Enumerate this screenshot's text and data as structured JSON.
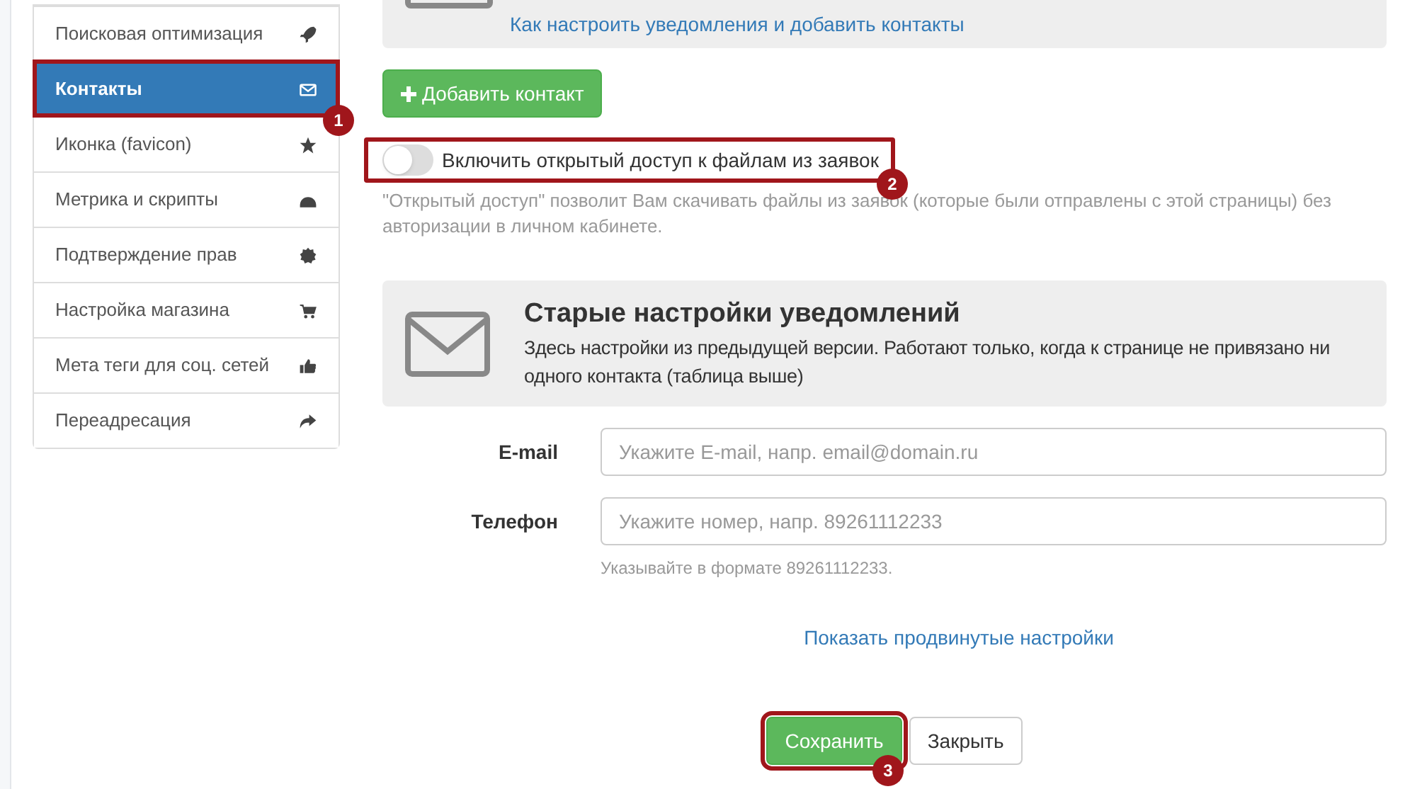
{
  "sidebar": {
    "items": [
      {
        "label": "Поисковая оптимизация",
        "selected": false
      },
      {
        "label": "Контакты",
        "selected": true
      },
      {
        "label": "Иконка (favicon)",
        "selected": false
      },
      {
        "label": "Метрика и скрипты",
        "selected": false
      },
      {
        "label": "Подтверждение прав",
        "selected": false
      },
      {
        "label": "Настройка магазина",
        "selected": false
      },
      {
        "label": "Мета теги для соц. сетей",
        "selected": false
      },
      {
        "label": "Переадресация",
        "selected": false
      }
    ]
  },
  "info_box": {
    "link": "Как настроить уведомления и добавить контакты"
  },
  "add_contact_button": "Добавить контакт",
  "open_access": {
    "label": "Включить открытый доступ к файлам из заявок",
    "on": false,
    "hint": "\"Открытый доступ\" позволит Вам скачивать файлы из заявок (которые были отправлены с этой страницы) без авторизации в личном кабинете."
  },
  "old_settings": {
    "title": "Старые настройки уведомлений",
    "text": "Здесь настройки из предыдущей версии. Работают только, когда к странице не привязано ни одного контакта (таблица выше)"
  },
  "fields": [
    {
      "label": "E-mail",
      "placeholder": "Укажите E-mail, напр. email@domain.ru"
    },
    {
      "label": "Телефон",
      "placeholder": "Укажите номер, напр. 89261112233",
      "hint": "Указывайте в формате 89261112233."
    }
  ],
  "advanced_link": "Показать продвинутые настройки",
  "buttons": [
    {
      "label": "Сохранить",
      "kind": "primary"
    },
    {
      "label": "Закрыть",
      "kind": "default"
    }
  ],
  "annotations": [
    "1",
    "2",
    "3"
  ]
}
